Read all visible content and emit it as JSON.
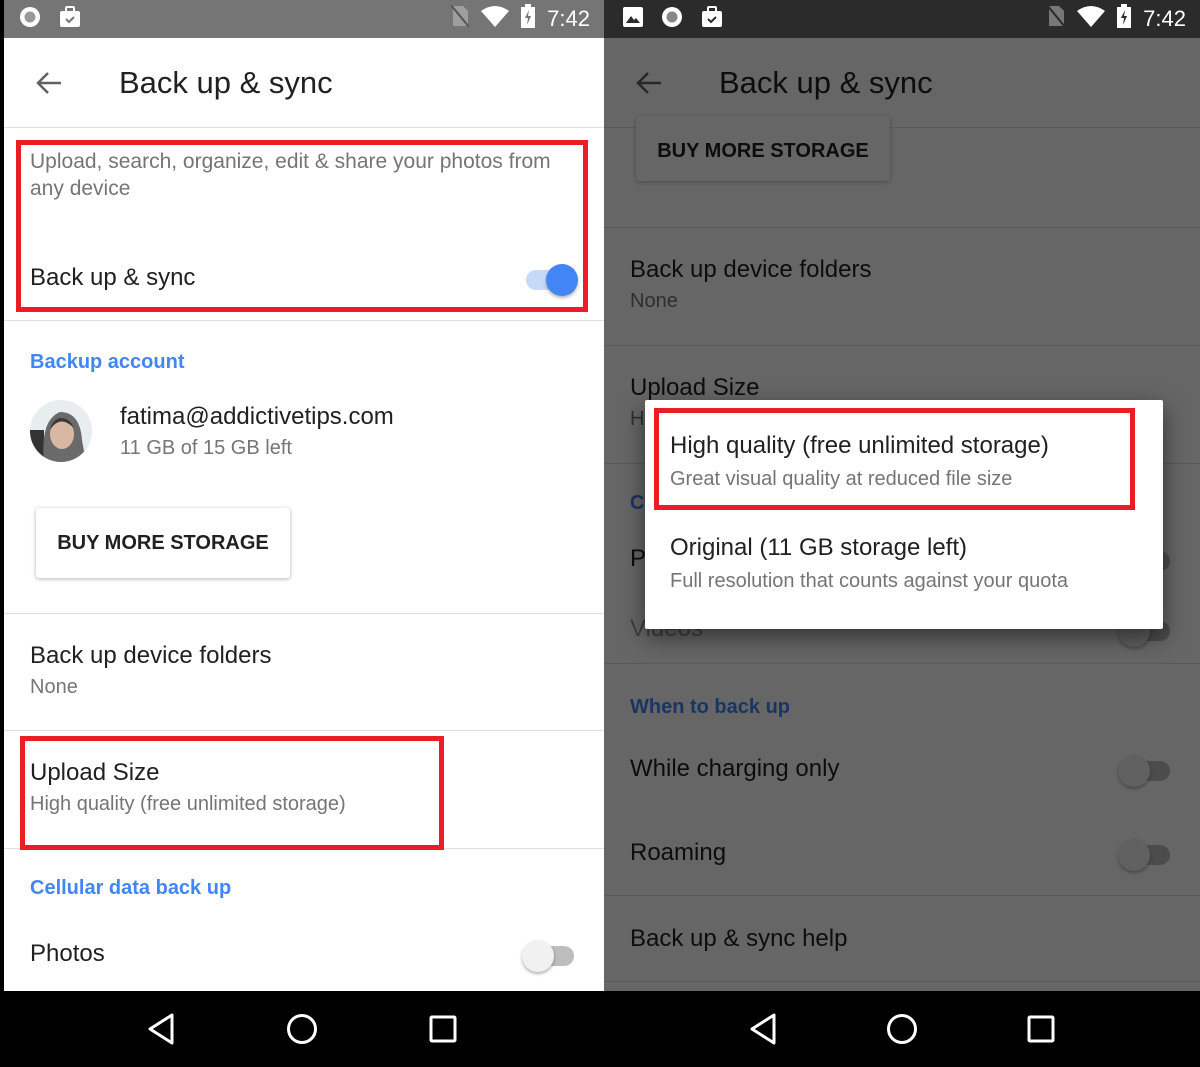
{
  "status_bar": {
    "time": "7:42",
    "left_icons_primary": [
      "record-icon",
      "clipboard-check-icon"
    ],
    "left_icons_secondary": [
      "image-icon",
      "record-icon",
      "clipboard-check-icon"
    ],
    "right_icons": [
      "no-sim-icon",
      "wifi-icon",
      "battery-charging-icon"
    ]
  },
  "app": {
    "title": "Back up & sync"
  },
  "settings": {
    "description": "Upload, search, organize, edit & share your photos from any device",
    "backup_sync": {
      "label": "Back up & sync",
      "enabled": true
    },
    "backup_account_header": "Backup account",
    "account": {
      "email": "fatima@addictivetips.com",
      "storage": "11 GB of 15 GB left"
    },
    "buy_storage_label": "BUY MORE STORAGE",
    "device_folders": {
      "label": "Back up device folders",
      "value": "None"
    },
    "upload_size": {
      "label": "Upload Size",
      "value": "High quality (free unlimited storage)",
      "value_truncated": "H"
    },
    "cellular_header": "Cellular data back up",
    "cellular_header_truncated": "C",
    "photos": {
      "label": "Photos",
      "label_truncated": "P",
      "enabled": false
    },
    "videos": {
      "label": "Videos",
      "enabled": false
    },
    "when_header": "When to back up",
    "charging_only": {
      "label": "While charging only",
      "enabled": false
    },
    "roaming": {
      "label": "Roaming",
      "enabled": false
    },
    "help_label": "Back up & sync help"
  },
  "upload_size_dialog": {
    "options": [
      {
        "title": "High quality (free unlimited storage)",
        "subtitle": "Great visual quality at reduced file size",
        "highlighted": true
      },
      {
        "title": "Original (11 GB storage left)",
        "subtitle": "Full resolution that counts against your quota",
        "highlighted": false
      }
    ]
  },
  "nav_bar": {
    "buttons": [
      "back",
      "home",
      "recents"
    ]
  },
  "colors": {
    "accent": "#4285f4",
    "highlight_box": "#ec1c24",
    "scrim": "#000000"
  }
}
